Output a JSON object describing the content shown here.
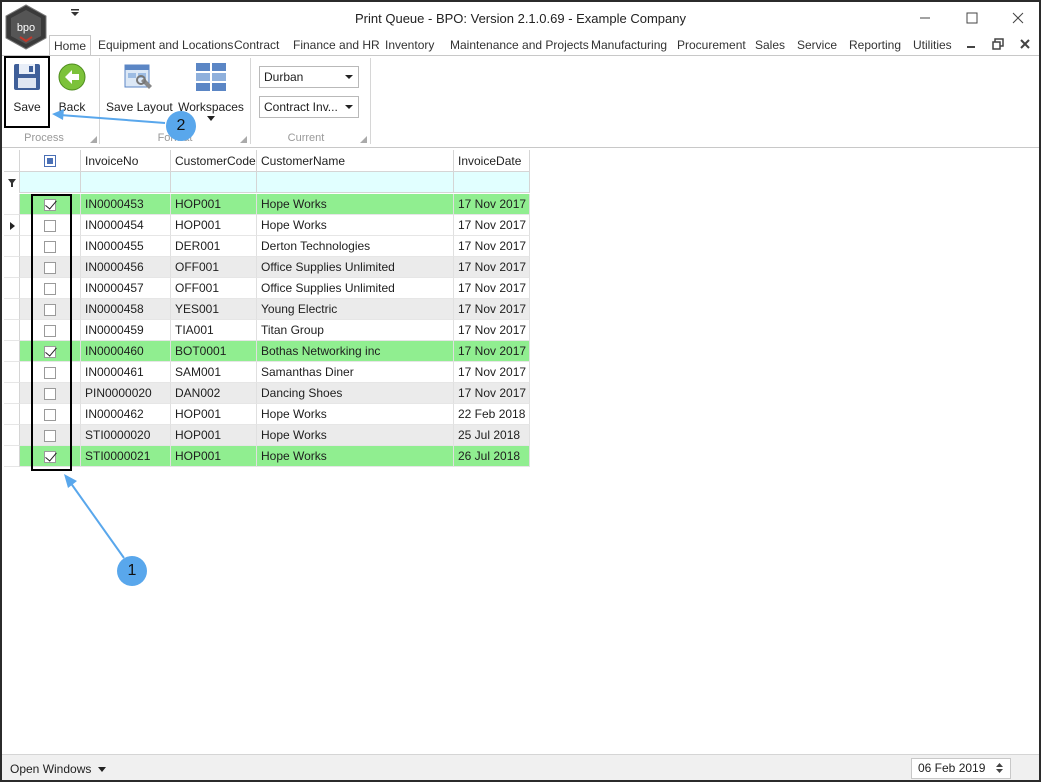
{
  "window": {
    "title": "Print Queue - BPO: Version 2.1.0.69 - Example Company",
    "logo_text": "bpo"
  },
  "ribbon_tabs": [
    {
      "label": "Home",
      "active": true
    },
    {
      "label": "Equipment and Locations"
    },
    {
      "label": "Contract"
    },
    {
      "label": "Finance and HR"
    },
    {
      "label": "Inventory"
    },
    {
      "label": "Maintenance and Projects"
    },
    {
      "label": "Manufacturing"
    },
    {
      "label": "Procurement"
    },
    {
      "label": "Sales"
    },
    {
      "label": "Service"
    },
    {
      "label": "Reporting"
    },
    {
      "label": "Utilities"
    }
  ],
  "ribbon": {
    "process": {
      "label": "Process",
      "save": "Save",
      "back": "Back"
    },
    "format": {
      "label": "Format",
      "save_layout": "Save Layout",
      "workspaces": "Workspaces"
    },
    "current": {
      "label": "Current",
      "site": "Durban",
      "report": "Contract Inv..."
    }
  },
  "grid": {
    "columns": [
      "InvoiceNo",
      "CustomerCode",
      "CustomerName",
      "InvoiceDate"
    ],
    "rows": [
      {
        "checked": true,
        "no": "IN0000453",
        "code": "HOP001",
        "name": "Hope Works",
        "date": "17 Nov 2017"
      },
      {
        "checked": false,
        "no": "IN0000454",
        "code": "HOP001",
        "name": "Hope Works",
        "date": "17 Nov 2017",
        "focused": true
      },
      {
        "checked": false,
        "no": "IN0000455",
        "code": "DER001",
        "name": "Derton Technologies",
        "date": "17 Nov 2017"
      },
      {
        "checked": false,
        "no": "IN0000456",
        "code": "OFF001",
        "name": "Office Supplies Unlimited",
        "date": "17 Nov 2017"
      },
      {
        "checked": false,
        "no": "IN0000457",
        "code": "OFF001",
        "name": "Office Supplies Unlimited",
        "date": "17 Nov 2017"
      },
      {
        "checked": false,
        "no": "IN0000458",
        "code": "YES001",
        "name": "Young Electric",
        "date": "17 Nov 2017"
      },
      {
        "checked": false,
        "no": "IN0000459",
        "code": "TIA001",
        "name": "Titan Group",
        "date": "17 Nov 2017"
      },
      {
        "checked": true,
        "no": "IN0000460",
        "code": "BOT0001",
        "name": "Bothas Networking inc",
        "date": "17 Nov 2017"
      },
      {
        "checked": false,
        "no": "IN0000461",
        "code": "SAM001",
        "name": "Samanthas Diner",
        "date": "17 Nov 2017"
      },
      {
        "checked": false,
        "no": "PIN0000020",
        "code": "DAN002",
        "name": "Dancing Shoes",
        "date": "17 Nov 2017"
      },
      {
        "checked": false,
        "no": "IN0000462",
        "code": "HOP001",
        "name": "Hope Works",
        "date": "22 Feb 2018"
      },
      {
        "checked": false,
        "no": "STI0000020",
        "code": "HOP001",
        "name": "Hope Works",
        "date": "25 Jul 2018"
      },
      {
        "checked": true,
        "no": "STI0000021",
        "code": "HOP001",
        "name": "Hope Works",
        "date": "26 Jul 2018"
      }
    ]
  },
  "statusbar": {
    "open_windows": "Open Windows",
    "date": "06 Feb 2019"
  },
  "callouts": {
    "one": "1",
    "two": "2"
  },
  "colors": {
    "selected_row": "#90ee90",
    "alt_row": "#ebebeb",
    "filter_row": "#e1ffff",
    "callout": "#59a7ec"
  }
}
